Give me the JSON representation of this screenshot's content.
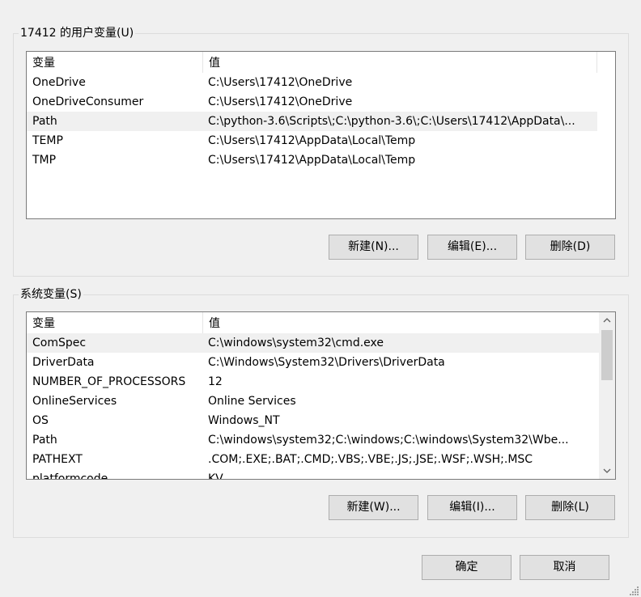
{
  "user_vars": {
    "group_title": "17412 的用户变量(U)",
    "columns": [
      "变量",
      "值"
    ],
    "rows": [
      {
        "name": "OneDrive",
        "value": "C:\\Users\\17412\\OneDrive"
      },
      {
        "name": "OneDriveConsumer",
        "value": "C:\\Users\\17412\\OneDrive"
      },
      {
        "name": "Path",
        "value": "C:\\python-3.6\\Scripts\\;C:\\python-3.6\\;C:\\Users\\17412\\AppData\\..."
      },
      {
        "name": "TEMP",
        "value": "C:\\Users\\17412\\AppData\\Local\\Temp"
      },
      {
        "name": "TMP",
        "value": "C:\\Users\\17412\\AppData\\Local\\Temp"
      }
    ],
    "selected_index": 2,
    "buttons": {
      "new": "新建(N)...",
      "edit": "编辑(E)...",
      "delete": "删除(D)"
    }
  },
  "system_vars": {
    "group_title": "系统变量(S)",
    "columns": [
      "变量",
      "值"
    ],
    "rows": [
      {
        "name": "ComSpec",
        "value": "C:\\windows\\system32\\cmd.exe"
      },
      {
        "name": "DriverData",
        "value": "C:\\Windows\\System32\\Drivers\\DriverData"
      },
      {
        "name": "NUMBER_OF_PROCESSORS",
        "value": "12"
      },
      {
        "name": "OnlineServices",
        "value": "Online Services"
      },
      {
        "name": "OS",
        "value": "Windows_NT"
      },
      {
        "name": "Path",
        "value": "C:\\windows\\system32;C:\\windows;C:\\windows\\System32\\Wbe..."
      },
      {
        "name": "PATHEXT",
        "value": ".COM;.EXE;.BAT;.CMD;.VBS;.VBE;.JS;.JSE;.WSF;.WSH;.MSC"
      },
      {
        "name": "platformcode",
        "value": "KV"
      }
    ],
    "selected_index": 0,
    "buttons": {
      "new": "新建(W)...",
      "edit": "编辑(I)...",
      "delete": "删除(L)"
    }
  },
  "footer": {
    "ok": "确定",
    "cancel": "取消"
  }
}
